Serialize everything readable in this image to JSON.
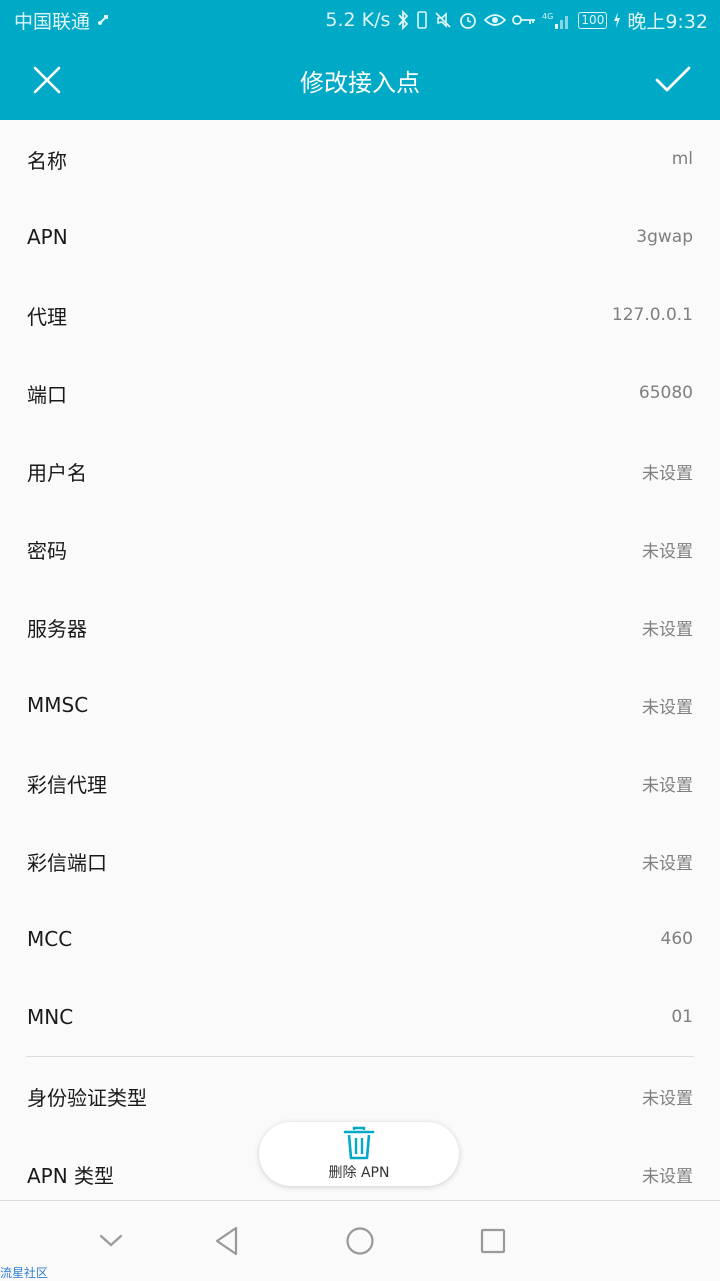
{
  "status_bar": {
    "carrier": "中国联通",
    "speed": "5.2 K/s",
    "network": "4G",
    "battery": "100",
    "time": "晚上9:32"
  },
  "app_bar": {
    "title": "修改接入点",
    "close_icon": "close-icon",
    "confirm_icon": "check-icon"
  },
  "fields": [
    {
      "label": "名称",
      "value": "ml"
    },
    {
      "label": "APN",
      "value": "3gwap"
    },
    {
      "label": "代理",
      "value": "127.0.0.1"
    },
    {
      "label": "端口",
      "value": "65080"
    },
    {
      "label": "用户名",
      "value": "未设置"
    },
    {
      "label": "密码",
      "value": "未设置"
    },
    {
      "label": "服务器",
      "value": "未设置"
    },
    {
      "label": "MMSC",
      "value": "未设置"
    },
    {
      "label": "彩信代理",
      "value": "未设置"
    },
    {
      "label": "彩信端口",
      "value": "未设置"
    },
    {
      "label": "MCC",
      "value": "460"
    },
    {
      "label": "MNC",
      "value": "01"
    },
    {
      "label": "身份验证类型",
      "value": "未设置"
    },
    {
      "label": "APN 类型",
      "value": "未设置"
    }
  ],
  "delete_button": {
    "label": "删除 APN",
    "icon": "trash-icon"
  },
  "nav_bar": {
    "icons": [
      "chevron-down-icon",
      "back-icon",
      "home-icon",
      "recents-icon"
    ]
  },
  "watermark": "流星社区",
  "colors": {
    "accent": "#00a9c6",
    "background": "#fafafa",
    "label": "#1a1a1a",
    "value": "#7f7f7f"
  }
}
